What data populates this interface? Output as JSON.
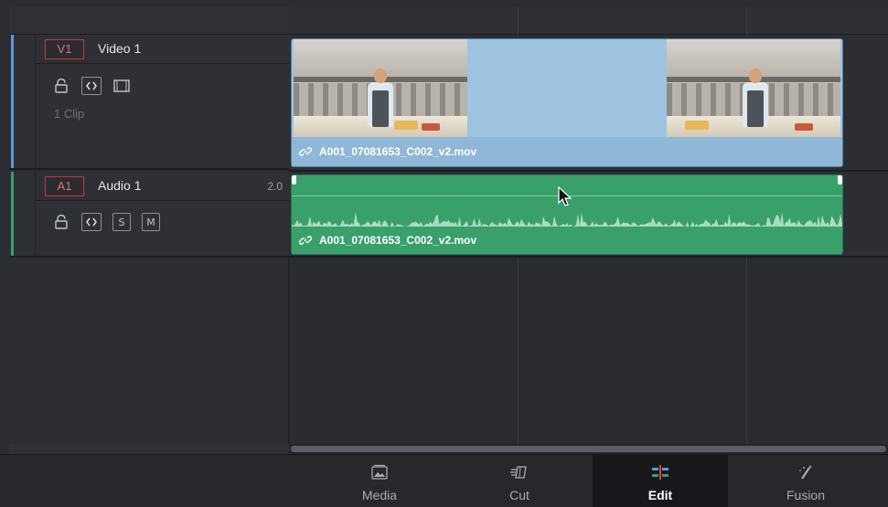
{
  "tracks": {
    "video": {
      "badge": "V1",
      "name": "Video 1",
      "clip_count": "1 Clip",
      "color": "#5b9bd5",
      "controls": [
        "lock-icon",
        "auto-select-icon",
        "track-visibility-icon"
      ]
    },
    "audio": {
      "badge": "A1",
      "name": "Audio 1",
      "channel": "2.0",
      "color": "#3aa06b",
      "controls": [
        "lock-icon",
        "auto-select-icon"
      ],
      "solo_label": "S",
      "mute_label": "M"
    }
  },
  "clips": {
    "video_clip": {
      "name": "A001_07081653_C002_v2.mov",
      "color": "#9ec3e0"
    },
    "audio_clip": {
      "name": "A001_07081653_C002_v2.mov",
      "color": "#3aa06b"
    }
  },
  "pages": {
    "tabs": [
      {
        "label": "Media",
        "icon": "media-page-icon",
        "active": false
      },
      {
        "label": "Cut",
        "icon": "cut-page-icon",
        "active": false
      },
      {
        "label": "Edit",
        "icon": "edit-page-icon",
        "active": true
      },
      {
        "label": "Fusion",
        "icon": "fusion-page-icon",
        "active": false
      }
    ]
  },
  "colors": {
    "accent_red": "#c23a33",
    "background": "#2b2d33"
  }
}
